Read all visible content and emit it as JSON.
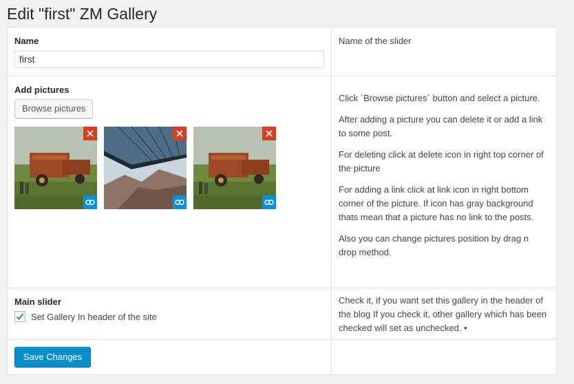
{
  "page": {
    "title": "Edit \"first\" ZM Gallery"
  },
  "name_row": {
    "label": "Name",
    "value": "first",
    "help": "Name of the slider"
  },
  "pictures_row": {
    "label": "Add pictures",
    "browse_label": "Browse pictures",
    "thumbnails": [
      {
        "image": "tractor-field-photo",
        "delete_icon": "close-icon",
        "link_icon": "link-icon"
      },
      {
        "image": "bridge-mountain-photo",
        "delete_icon": "close-icon",
        "link_icon": "link-icon"
      },
      {
        "image": "tractor-field-photo",
        "delete_icon": "close-icon",
        "link_icon": "link-icon"
      }
    ],
    "help": [
      "Click `Browse pictures` button and select a picture.",
      "After adding a picture you can delete it or add a link to some post.",
      "For deleting click at delete icon in right top corner of the picture",
      "For adding a link click at link icon in right bottom corner of the picture. If icon has gray background thats mean that a picture has no link to the posts.",
      "Also you can change pictures position by drag n drop method."
    ]
  },
  "main_slider_row": {
    "label": "Main slider",
    "checkbox_label": "Set Gallery In header of the site",
    "checked": true,
    "help": "Check it, if you want set this gallery in the header of the blog If you check it, other gallery which has been checked will set as unchecked. •"
  },
  "footer": {
    "save_label": "Save Changes"
  },
  "colors": {
    "delete_bg": "#dd3d1f",
    "link_bg": "#0a8fd6",
    "primary_button": "#0091cd",
    "checkbox_check": "#1e8cbe"
  }
}
